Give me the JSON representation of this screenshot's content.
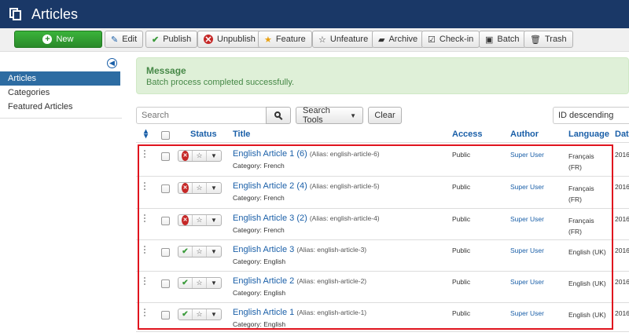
{
  "header": {
    "title": "Articles"
  },
  "toolbar": {
    "new_label": "New",
    "edit_label": "Edit",
    "publish_label": "Publish",
    "unpublish_label": "Unpublish",
    "feature_label": "Feature",
    "unfeature_label": "Unfeature",
    "archive_label": "Archive",
    "checkin_label": "Check-in",
    "batch_label": "Batch",
    "trash_label": "Trash"
  },
  "sidebar": {
    "items": [
      {
        "label": "Articles",
        "active": true
      },
      {
        "label": "Categories",
        "active": false
      },
      {
        "label": "Featured Articles",
        "active": false
      }
    ]
  },
  "message": {
    "title": "Message",
    "text": "Batch process completed successfully."
  },
  "filters": {
    "search_placeholder": "Search",
    "search_tools_label": "Search Tools",
    "clear_label": "Clear",
    "ordering_value": "ID descending"
  },
  "table": {
    "headers": {
      "status": "Status",
      "title": "Title",
      "access": "Access",
      "author": "Author",
      "language": "Language",
      "date": "Dat"
    },
    "rows": [
      {
        "title": "English Article 1 (6)",
        "alias": "(Alias: english-article-6)",
        "category": "Category: French",
        "access": "Public",
        "author": "Super User",
        "lang_line1": "Français",
        "lang_line2": "(FR)",
        "date": "2016",
        "published": false
      },
      {
        "title": "English Article 2 (4)",
        "alias": "(Alias: english-article-5)",
        "category": "Category: French",
        "access": "Public",
        "author": "Super User",
        "lang_line1": "Français",
        "lang_line2": "(FR)",
        "date": "2016",
        "published": false
      },
      {
        "title": "English Article 3 (2)",
        "alias": "(Alias: english-article-4)",
        "category": "Category: French",
        "access": "Public",
        "author": "Super User",
        "lang_line1": "Français",
        "lang_line2": "(FR)",
        "date": "2016",
        "published": false
      },
      {
        "title": "English Article 3",
        "alias": "(Alias: english-article-3)",
        "category": "Category: English",
        "access": "Public",
        "author": "Super User",
        "lang_line1": "English (UK)",
        "lang_line2": "",
        "date": "2016",
        "published": true
      },
      {
        "title": "English Article 2",
        "alias": "(Alias: english-article-2)",
        "category": "Category: English",
        "access": "Public",
        "author": "Super User",
        "lang_line1": "English (UK)",
        "lang_line2": "",
        "date": "2016",
        "published": true
      },
      {
        "title": "English Article 1",
        "alias": "(Alias: english-article-1)",
        "category": "Category: English",
        "access": "Public",
        "author": "Super User",
        "lang_line1": "English (UK)",
        "lang_line2": "",
        "date": "2016",
        "published": true
      }
    ]
  },
  "colors": {
    "header_bg": "#1a3867",
    "new_button": "#2a8a2a",
    "link": "#1a5fa8",
    "highlight_border": "#e0141e",
    "message_bg": "#dff0d8"
  }
}
